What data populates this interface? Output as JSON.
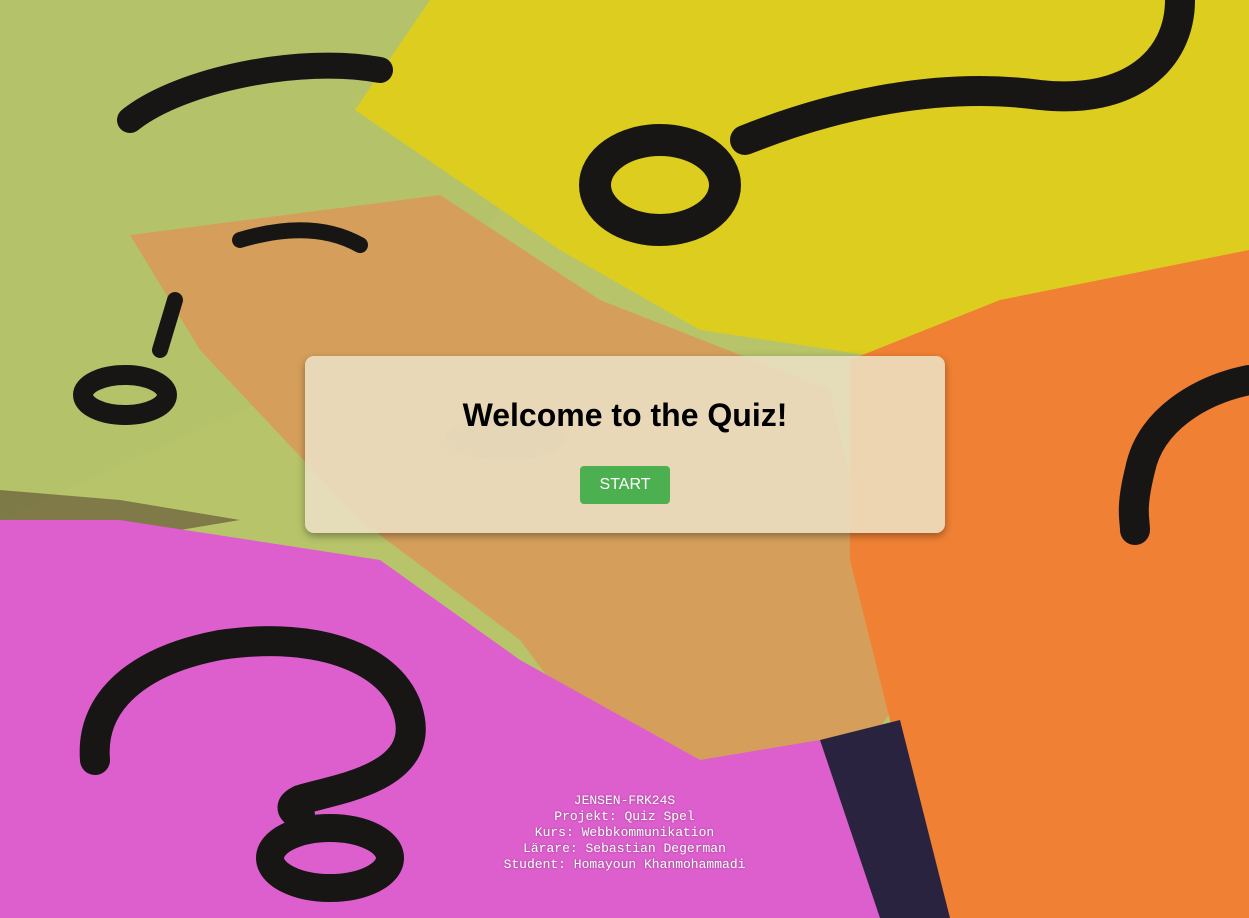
{
  "quiz": {
    "title": "Welcome to the Quiz!",
    "start_label": "START"
  },
  "footer": {
    "lines": [
      "JENSEN-FRK24S",
      "Projekt: Quiz Spel",
      "Kurs: Webbkommunikation",
      "Lärare: Sebastian Degerman",
      "Student: Homayoun Khanmohammadi"
    ]
  },
  "theme": {
    "button_color": "#4caf50",
    "card_color": "#ece0c4",
    "text_color": "#000000",
    "footer_text_color": "#ffffff"
  },
  "background": {
    "subject": "crumpled sticky notes with hand-drawn question marks",
    "note_colors": [
      "#b4c56a",
      "#e1d01e",
      "#d39a5a",
      "#f07d32",
      "#dc5ecd"
    ]
  }
}
